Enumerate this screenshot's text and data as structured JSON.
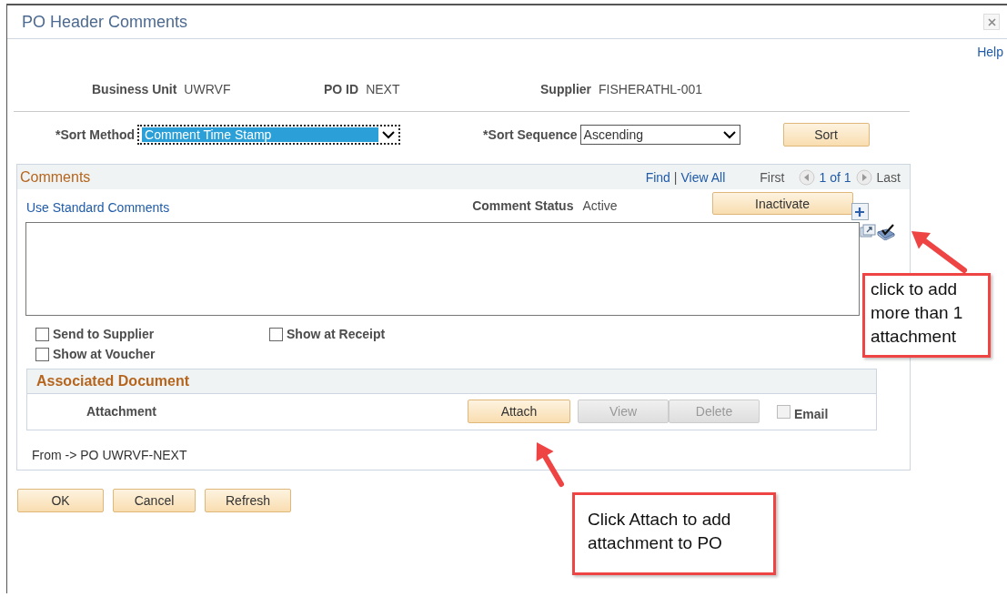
{
  "window": {
    "title": "PO Header Comments"
  },
  "help_link": "Help",
  "header_fields": [
    {
      "label": "Business Unit",
      "value": "UWRVF"
    },
    {
      "label": "PO ID",
      "value": "NEXT"
    },
    {
      "label": "Supplier",
      "value": "FISHERATHL-001"
    }
  ],
  "sort_method": {
    "label": "*Sort Method",
    "value": "Comment Time Stamp",
    "highlighted": true
  },
  "sort_sequence": {
    "label": "*Sort Sequence",
    "value": "Ascending",
    "highlighted": false
  },
  "sort_button": "Sort",
  "comments": {
    "title": "Comments",
    "find": "Find",
    "separator": "|",
    "view_all": "View All",
    "first": "First",
    "page": "1 of 1",
    "last": "Last",
    "standard_comments_link": "Use Standard Comments",
    "status_label": "Comment Status",
    "status_value": "Active",
    "inactivate_button": "Inactivate",
    "checkboxes": [
      {
        "label": "Send to Supplier",
        "checked": false
      },
      {
        "label": "Show at Receipt",
        "checked": false
      },
      {
        "label": "Show at Voucher",
        "checked": false
      }
    ],
    "associated_document": {
      "title": "Associated Document",
      "attachment_label": "Attachment",
      "buttons": [
        {
          "label": "Attach",
          "disabled": false
        },
        {
          "label": "View",
          "disabled": true
        },
        {
          "label": "Delete",
          "disabled": true
        }
      ],
      "email": {
        "label": "Email",
        "checked": false,
        "disabled": true
      }
    },
    "from_text": "From -> PO UWRVF-NEXT"
  },
  "footer_buttons": [
    "OK",
    "Cancel",
    "Refresh"
  ],
  "callouts": [
    {
      "text": "click to add more than 1 attachment"
    },
    {
      "text": "Click Attach to add attachment to PO"
    }
  ]
}
